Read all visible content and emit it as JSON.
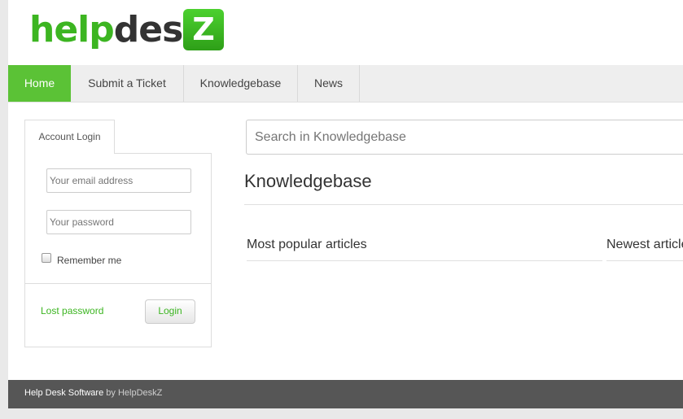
{
  "logo": {
    "text_part1": "help",
    "text_part2": "desk",
    "box_letter": "Z"
  },
  "nav": {
    "items": [
      {
        "label": "Home",
        "active": true
      },
      {
        "label": "Submit a Ticket"
      },
      {
        "label": "Knowledgebase"
      },
      {
        "label": "News"
      }
    ]
  },
  "login": {
    "tab_label": "Account Login",
    "email_placeholder": "Your email address",
    "password_placeholder": "Your password",
    "remember_label": "Remember me",
    "lost_password_label": "Lost password",
    "login_button_label": "Login"
  },
  "main": {
    "search_placeholder": "Search in Knowledgebase",
    "title": "Knowledgebase",
    "popular_title": "Most popular articles",
    "newest_title": "Newest articles"
  },
  "footer": {
    "link_label": "Help Desk Software",
    "by_text": "by HelpDeskZ"
  },
  "colors": {
    "accent": "#5bc236",
    "footer_bg": "#565656"
  }
}
